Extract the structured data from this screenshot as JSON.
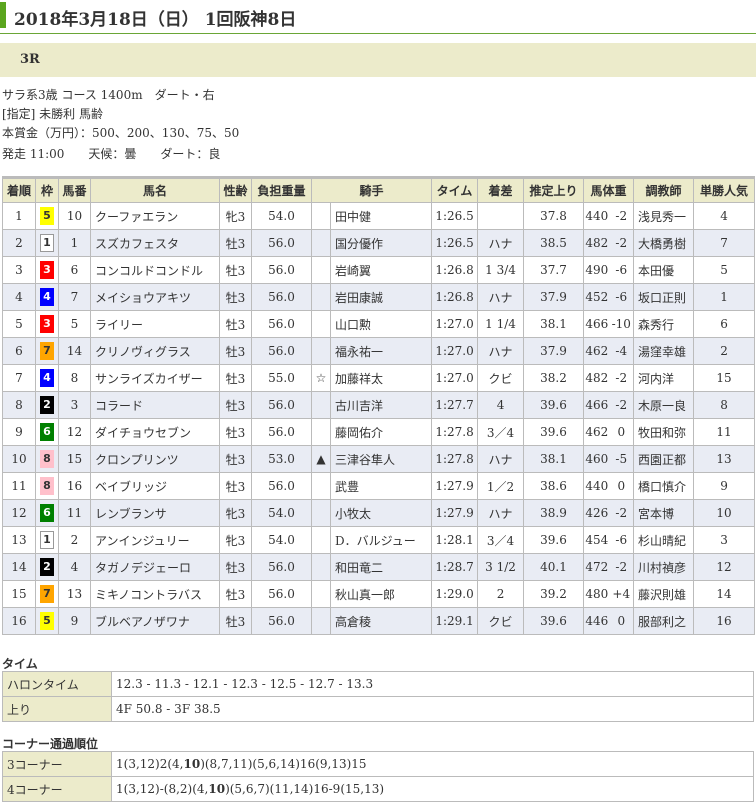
{
  "header": {
    "title": "2018年3月18日（日） 1回阪神8日",
    "race": "3R"
  },
  "info": [
    "サラ系3歳 コース 1400m　ダート・右",
    "[指定] 未勝利 馬齢",
    "本賞金（万円）：500、200、130、75、50",
    "発走 11:00　　天候：曇　　ダート：良"
  ],
  "columns": [
    "着順",
    "枠",
    "馬番",
    "馬名",
    "性齢",
    "負担重量",
    "騎手",
    "タイム",
    "着差",
    "推定上り",
    "馬体重",
    "調教師",
    "単勝人気"
  ],
  "frame_colors": {
    "1": [
      "#ffffff",
      "#333"
    ],
    "2": [
      "#000000",
      "#fff"
    ],
    "3": [
      "#ff0000",
      "#fff"
    ],
    "4": [
      "#0000ff",
      "#fff"
    ],
    "5": [
      "#ffff00",
      "#333"
    ],
    "6": [
      "#008000",
      "#fff"
    ],
    "7": [
      "#ffa500",
      "#333"
    ],
    "8": [
      "#ffc0cb",
      "#333"
    ]
  },
  "rows": [
    [
      "1",
      "5",
      "10",
      "クーファエラン",
      "牝3",
      "54.0",
      "",
      "田中健",
      "1:26.5",
      "",
      "37.8",
      "440",
      "-2",
      "浅見秀一",
      "4"
    ],
    [
      "2",
      "1",
      "1",
      "スズカフェスタ",
      "牡3",
      "56.0",
      "",
      "国分優作",
      "1:26.5",
      "ハナ",
      "38.5",
      "482",
      "-2",
      "大橋勇樹",
      "7"
    ],
    [
      "3",
      "3",
      "6",
      "コンコルドコンドル",
      "牡3",
      "56.0",
      "",
      "岩崎翼",
      "1:26.8",
      "1 3/4",
      "37.7",
      "490",
      "-6",
      "本田優",
      "5"
    ],
    [
      "4",
      "4",
      "7",
      "メイショウアキツ",
      "牡3",
      "56.0",
      "",
      "岩田康誠",
      "1:26.8",
      "ハナ",
      "37.9",
      "452",
      "-6",
      "坂口正則",
      "1"
    ],
    [
      "5",
      "3",
      "5",
      "ライリー",
      "牡3",
      "56.0",
      "",
      "山口勲",
      "1:27.0",
      "1 1/4",
      "38.1",
      "466",
      "-10",
      "森秀行",
      "6"
    ],
    [
      "6",
      "7",
      "14",
      "クリノヴィグラス",
      "牡3",
      "56.0",
      "",
      "福永祐一",
      "1:27.0",
      "ハナ",
      "37.9",
      "462",
      "-4",
      "湯窪幸雄",
      "2"
    ],
    [
      "7",
      "4",
      "8",
      "サンライズカイザー",
      "牡3",
      "55.0",
      "☆",
      "加藤祥太",
      "1:27.0",
      "クビ",
      "38.2",
      "482",
      "-2",
      "河内洋",
      "15"
    ],
    [
      "8",
      "2",
      "3",
      "コラード",
      "牡3",
      "56.0",
      "",
      "古川吉洋",
      "1:27.7",
      "4",
      "39.6",
      "466",
      "-2",
      "木原一良",
      "8"
    ],
    [
      "9",
      "6",
      "12",
      "ダイチョウセブン",
      "牡3",
      "56.0",
      "",
      "藤岡佑介",
      "1:27.8",
      "3／4",
      "39.6",
      "462",
      "0",
      "牧田和弥",
      "11"
    ],
    [
      "10",
      "8",
      "15",
      "クロンプリンツ",
      "牡3",
      "53.0",
      "▲",
      "三津谷隼人",
      "1:27.8",
      "ハナ",
      "38.1",
      "460",
      "-5",
      "西園正都",
      "13"
    ],
    [
      "11",
      "8",
      "16",
      "ベイブリッジ",
      "牡3",
      "56.0",
      "",
      "武豊",
      "1:27.9",
      "1／2",
      "38.6",
      "440",
      "0",
      "橋口慎介",
      "9"
    ],
    [
      "12",
      "6",
      "11",
      "レンブランサ",
      "牝3",
      "54.0",
      "",
      "小牧太",
      "1:27.9",
      "ハナ",
      "38.9",
      "426",
      "-2",
      "宮本博",
      "10"
    ],
    [
      "13",
      "1",
      "2",
      "アンインジュリー",
      "牝3",
      "54.0",
      "",
      "D．バルジュー",
      "1:28.1",
      "3／4",
      "39.6",
      "454",
      "-6",
      "杉山晴紀",
      "3"
    ],
    [
      "14",
      "2",
      "4",
      "タガノデジェーロ",
      "牡3",
      "56.0",
      "",
      "和田竜二",
      "1:28.7",
      "3 1/2",
      "40.1",
      "472",
      "-2",
      "川村禎彦",
      "12"
    ],
    [
      "15",
      "7",
      "13",
      "ミキノコントラバス",
      "牡3",
      "56.0",
      "",
      "秋山真一郎",
      "1:29.0",
      "2",
      "39.2",
      "480",
      "+4",
      "藤沢則雄",
      "14"
    ],
    [
      "16",
      "5",
      "9",
      "ブルベアノザワナ",
      "牡3",
      "56.0",
      "",
      "高倉稜",
      "1:29.1",
      "クビ",
      "39.6",
      "446",
      "0",
      "服部利之",
      "16"
    ]
  ],
  "time": {
    "heading": "タイム",
    "furlong_label": "ハロンタイム",
    "furlong": "12.3 - 11.3 - 12.1 - 12.3 - 12.5 - 12.7 - 13.3",
    "agari_label": "上り",
    "agari": "4F 50.8 - 3F 38.5"
  },
  "corners": {
    "heading": "コーナー通過順位",
    "c3_label": "3コーナー",
    "c3": {
      "pre": "1(3,12)2(4,",
      "bold": "10",
      "post": ")(8,7,11)(5,6,14)16(9,13)15"
    },
    "c4_label": "4コーナー",
    "c4": {
      "pre": "1(3,12)-(8,2)(4,",
      "bold": "10",
      "post": ")(5,6,7)(11,14)16-9(15,13)"
    }
  }
}
